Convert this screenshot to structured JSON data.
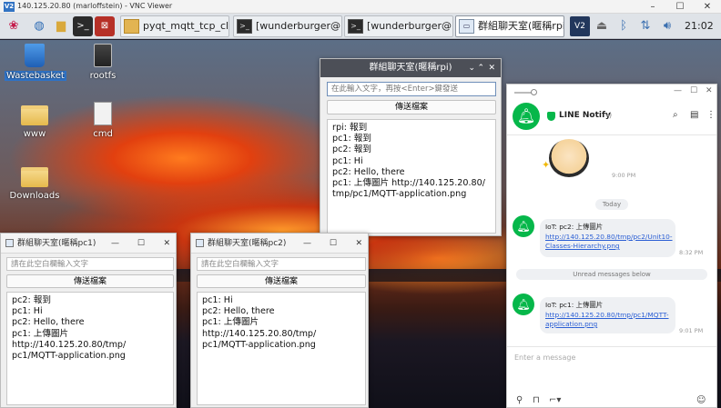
{
  "vnc": {
    "title": "140.125.20.80 (marloffstein) - VNC Viewer",
    "logo": "V2",
    "minimize": "–",
    "maximize": "☐",
    "close": "✕"
  },
  "taskbar": {
    "tasks": [
      "pyqt_mqtt_tcp_clien...",
      "[wunderburger@marl...",
      "[wunderburger@marl...",
      "群組聊天室(暱稱rpi)"
    ],
    "clock": "21:02",
    "tray_logo": "V2"
  },
  "desktop": {
    "icons": [
      "Wastebasket",
      "rootfs",
      "www",
      "cmd",
      "Downloads"
    ]
  },
  "main_window": {
    "title": "群組聊天室(暱稱rpi)",
    "input_placeholder": "在此輸入文字，再按<Enter>鍵發送",
    "button": "傳送檔案",
    "log": "rpi: 報到\npc1: 報到\npc2: 報到\npc1: Hi\npc2: Hello, there\npc1: 上傳圖片 http://140.125.20.80/\ntmp/pc1/MQTT-application.png"
  },
  "pc1_window": {
    "title": "群組聊天室(暱稱pc1)",
    "input_placeholder": "請在此空白欄輸入文字",
    "button": "傳送檔案",
    "log": "pc2: 報到\npc1: Hi\npc2: Hello, there\npc1: 上傳圖片 http://140.125.20.80/tmp/\npc1/MQTT-application.png"
  },
  "pc2_window": {
    "title": "群組聊天室(暱稱pc2)",
    "input_placeholder": "請在此空白欄輸入文字",
    "button": "傳送檔案",
    "log": "pc1: Hi\npc2: Hello, there\npc1: 上傳圖片 http://140.125.20.80/tmp/\npc1/MQTT-application.png"
  },
  "line": {
    "name": "LINE Notify",
    "sticker_time": "9:00 PM",
    "today": "Today",
    "unread": "Unread messages below",
    "input_placeholder": "Enter a message",
    "messages": [
      {
        "prefix": "IoT: pc2: 上傳圖片 ",
        "link": "http://140.125.20.80/tmp/pc2/Unit10-Classes-Hierarchy.png",
        "time": "8:32 PM"
      },
      {
        "prefix": "IoT: pc1: 上傳圖片 ",
        "link": "http://140.125.20.80/tmp/pc1/MQTT-application.png",
        "time": "9:01 PM"
      }
    ]
  },
  "colors": {
    "line_green": "#06b74a",
    "link": "#2a5ed4"
  }
}
